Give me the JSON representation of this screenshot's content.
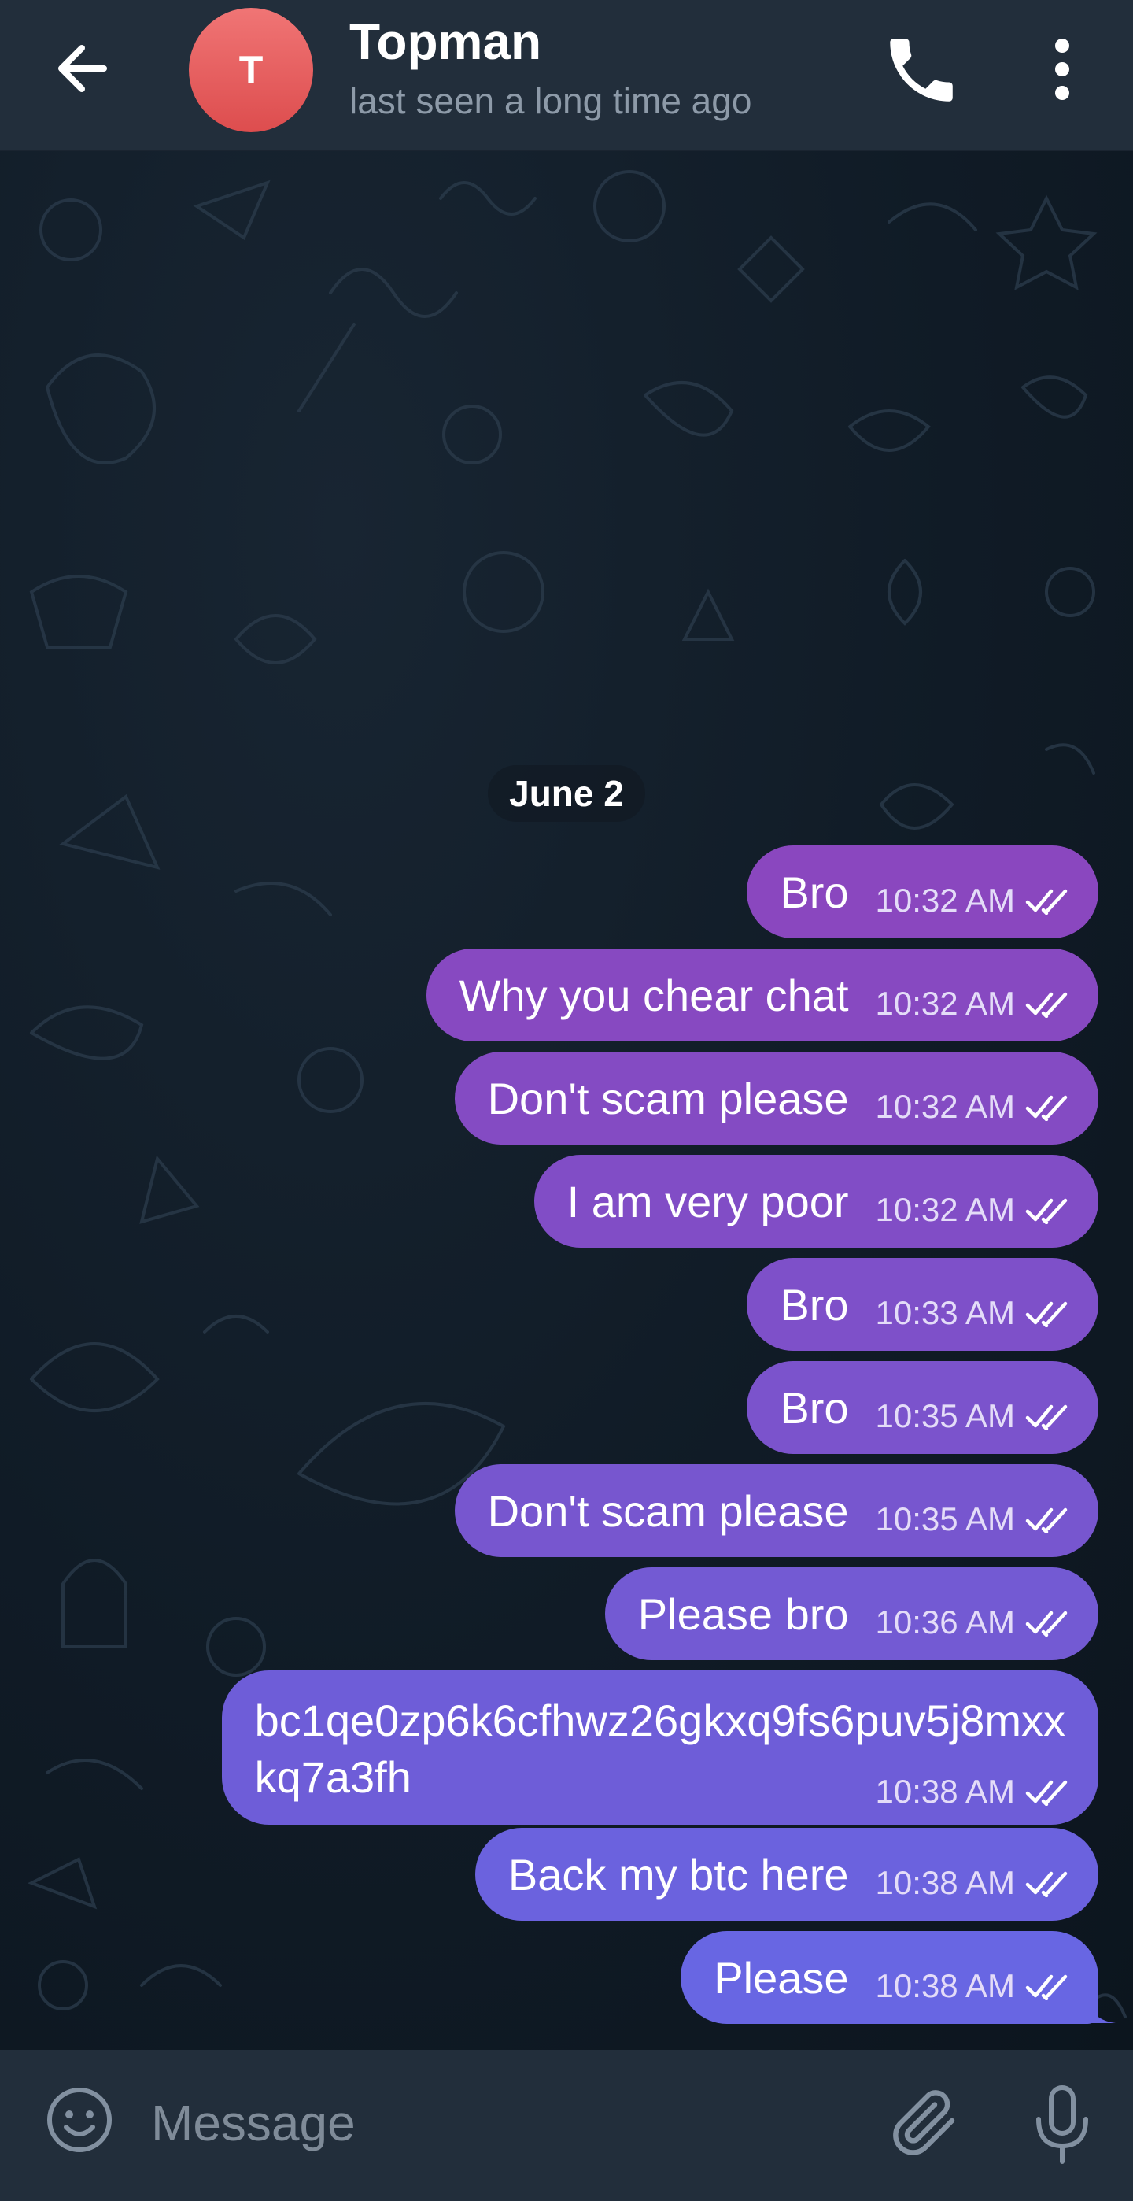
{
  "header": {
    "contact_name": "Topman",
    "status": "last seen a long time ago",
    "avatar_initial": "T",
    "avatar_color": "#e45f60",
    "icons": [
      "arrow-left-icon",
      "phone-icon",
      "more-vertical-icon"
    ]
  },
  "chat": {
    "date_label": "June 2",
    "messages": [
      {
        "text": "Bro",
        "time": "10:32 AM",
        "status": "read"
      },
      {
        "text": "Why you chear chat",
        "time": "10:32 AM",
        "status": "read"
      },
      {
        "text": "Don't scam please",
        "time": "10:32 AM",
        "status": "read"
      },
      {
        "text": "I am very poor",
        "time": "10:32 AM",
        "status": "read"
      },
      {
        "text": "Bro",
        "time": "10:33 AM",
        "status": "read"
      },
      {
        "text": "Bro",
        "time": "10:35 AM",
        "status": "read"
      },
      {
        "text": "Don't scam please",
        "time": "10:35 AM",
        "status": "read"
      },
      {
        "text": "Please bro",
        "time": "10:36 AM",
        "status": "read"
      },
      {
        "text": "bc1qe0zp6k6cfhwz26gkxq9fs6puv5j8mxx\nkq7a3fh",
        "time": "10:38 AM",
        "status": "read"
      },
      {
        "text": "Back my btc here",
        "time": "10:38 AM",
        "status": "read"
      },
      {
        "text": "Please",
        "time": "10:38 AM",
        "status": "read"
      }
    ],
    "bubble_color_top": "#8848c0",
    "bubble_color_bottom": "#6b6ae6"
  },
  "input": {
    "placeholder": "Message",
    "icons": [
      "emoji-icon",
      "paperclip-icon",
      "microphone-icon"
    ]
  }
}
